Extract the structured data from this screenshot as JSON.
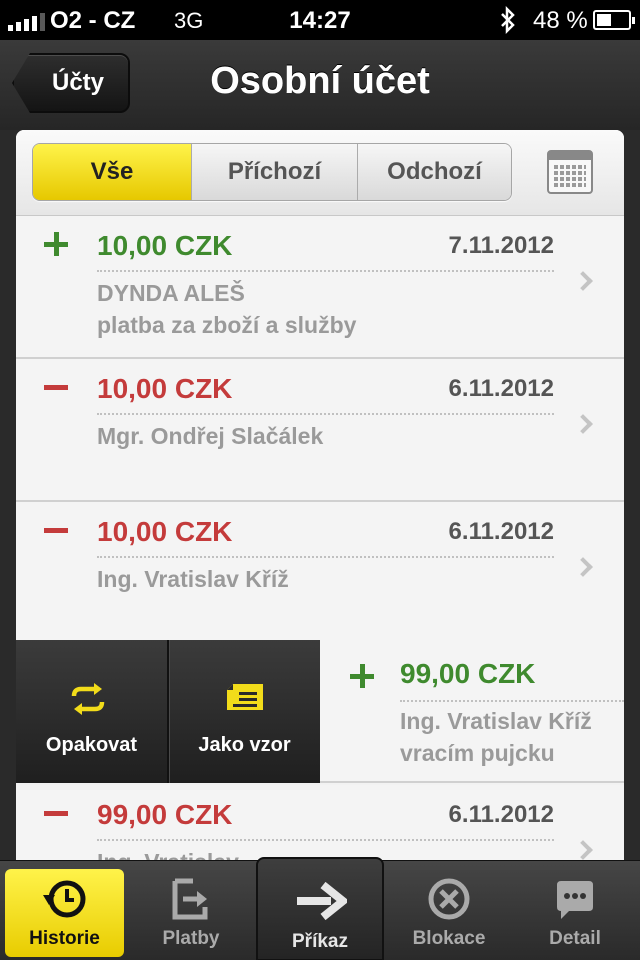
{
  "status_bar": {
    "carrier": "O2 - CZ",
    "network": "3G",
    "time": "14:27",
    "battery": "48 %",
    "battery_level": 0.48
  },
  "nav": {
    "back_label": "Účty",
    "title": "Osobní účet"
  },
  "filters": {
    "segments": [
      "Vše",
      "Příchozí",
      "Odchozí"
    ],
    "active": "Vše"
  },
  "transactions": [
    {
      "sign": "+",
      "amount": "10,00 CZK",
      "date": "7.11.2012",
      "line1": "DYNDA ALEŠ",
      "line2": "platba za zboží a služby"
    },
    {
      "sign": "−",
      "amount": "10,00 CZK",
      "date": "6.11.2012",
      "line1": "Mgr. Ondřej Slačálek",
      "line2": ""
    },
    {
      "sign": "−",
      "amount": "10,00 CZK",
      "date": "6.11.2012",
      "line1": "Ing. Vratislav Kříž",
      "line2": ""
    },
    {
      "sign": "+",
      "amount": "99,00 CZK",
      "date": "",
      "line1": "Ing. Vratislav Kříž",
      "line2": "vracím pujcku"
    },
    {
      "sign": "−",
      "amount": "99,00 CZK",
      "date": "6.11.2012",
      "line1": "Ing. Vratislav",
      "line2": ""
    }
  ],
  "swipe_actions": {
    "repeat": "Opakovat",
    "as_template": "Jako vzor"
  },
  "tabs": {
    "history": "Historie",
    "payments": "Platby",
    "order": "Příkaz",
    "blocks": "Blokace",
    "detail": "Detail"
  },
  "colors": {
    "accent_yellow": "#f2dc1a",
    "income_green": "#3f8a2e",
    "expense_red": "#c43b3b"
  }
}
